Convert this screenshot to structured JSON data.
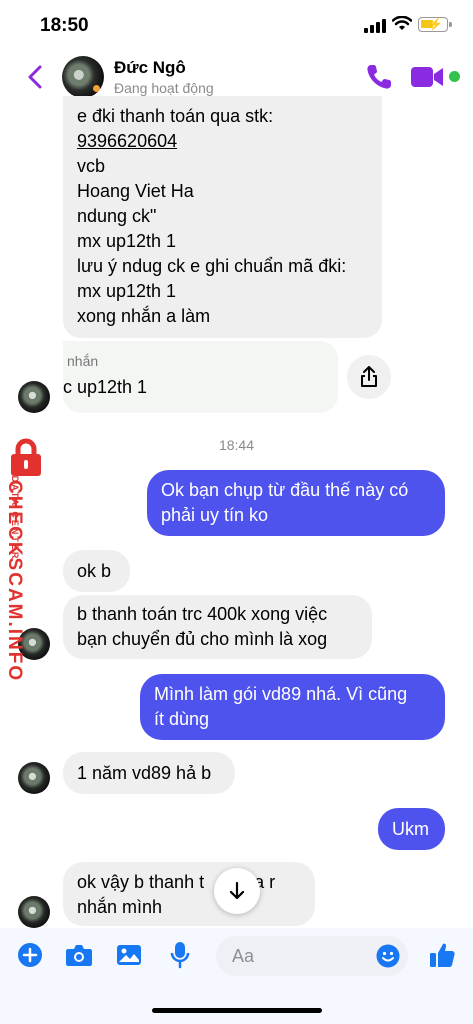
{
  "status_bar": {
    "time": "18:50"
  },
  "header": {
    "contact_name": "Đức Ngô",
    "contact_status": "Đang hoạt động"
  },
  "messages": {
    "m1": {
      "lines": [
        "e đki thanh toán qua stk:",
        "9396620604",
        "vcb",
        "Hoang Viet Ha",
        "ndung ck\"",
        "mx up12th 1",
        "lưu ý ndug ck e ghi chuẩn mã đki:",
        "mx up12th 1",
        "xong nhắn a làm"
      ]
    },
    "m2": {
      "line1": "nhắn",
      "line2": "c up12th 1"
    },
    "timestamp": "18:44",
    "m3": {
      "lines": [
        "Ok bạn chụp từ đầu thế này có",
        "phải uy tín ko"
      ]
    },
    "m4": {
      "lines": [
        "ok b"
      ]
    },
    "m5": {
      "lines": [
        "b thanh toán trc 400k xong việc",
        "bạn chuyển đủ cho mình là xog"
      ]
    },
    "m6": {
      "lines": [
        "Mình làm gói vd89 nhá. Vì cũng",
        "ít dùng"
      ]
    },
    "m7": {
      "lines": [
        "1 năm vd89 hả b"
      ]
    },
    "m8": {
      "lines": [
        "Ukm"
      ]
    },
    "m9": {
      "lines": [
        "ok vậy b thanh t      qua r",
        "nhắn mình"
      ]
    }
  },
  "watermark": {
    "brand": "CHECKSCAM.INFO",
    "sub": "DATA CENTER"
  },
  "composer": {
    "placeholder": "Aa"
  },
  "colors": {
    "accent": "#8a2be2",
    "outgoing_bubble": "#4f53ee",
    "incoming_bubble": "#efefef",
    "online": "#31c24d",
    "composer_icons": "#1877f2",
    "watermark": "#e1322f"
  }
}
